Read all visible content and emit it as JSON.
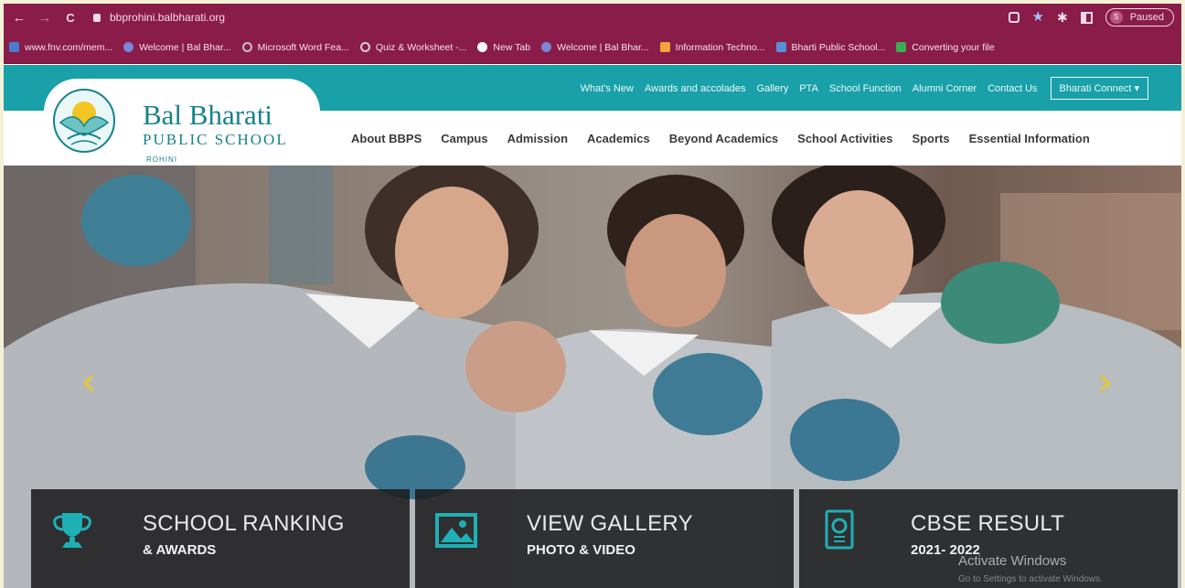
{
  "browser": {
    "url": "bbprohini.balbharati.org",
    "profile_status": "Paused",
    "profile_initial": "S",
    "nav": {
      "back": "←",
      "forward": "→",
      "reload": "C"
    }
  },
  "bookmarks": [
    {
      "label": "www.fnv.com/mem...",
      "color": "#4a7bd1"
    },
    {
      "label": "Welcome | Bal Bhar...",
      "color": "#7a86d6"
    },
    {
      "label": "Microsoft Word Fea...",
      "color": "#c9c0c4"
    },
    {
      "label": "Quiz & Worksheet -...",
      "color": "#d7cfd2"
    },
    {
      "label": "New Tab",
      "color": "#ffffff"
    },
    {
      "label": "Welcome | Bal Bhar...",
      "color": "#7a86d6"
    },
    {
      "label": "Information Techno...",
      "color": "#f2a33a"
    },
    {
      "label": "Bharti Public School...",
      "color": "#5a8fd8"
    },
    {
      "label": "Converting your file",
      "color": "#3faa52"
    }
  ],
  "site": {
    "top_links": [
      "What's New",
      "Awards and accolades",
      "Gallery",
      "PTA",
      "School Function",
      "Alumni Corner",
      "Contact Us"
    ],
    "connect_label": "Bharati Connect ▾",
    "logo": {
      "title": "Bal Bharati",
      "subtitle": "PUBLIC SCHOOL",
      "location": "ROHINI"
    },
    "main_nav": [
      "About BBPS",
      "Campus",
      "Admission",
      "Academics",
      "Beyond Academics",
      "School Activities",
      "Sports",
      "Essential Information"
    ],
    "colors": {
      "teal": "#19a0a8",
      "browser": "#8a1c4a",
      "arrow": "#e7c630",
      "card_bg": "#18181a"
    }
  },
  "hero": {
    "arrows": {
      "prev": "‹",
      "next": "›"
    },
    "cards": [
      {
        "title": "SCHOOL RANKING",
        "subtitle": "& AWARDS",
        "icon": "trophy-icon"
      },
      {
        "title": "VIEW GALLERY",
        "subtitle": "PHOTO & VIDEO",
        "icon": "image-icon"
      },
      {
        "title": "CBSE RESULT",
        "subtitle": "2021- 2022",
        "icon": "certificate-icon"
      }
    ]
  },
  "os_watermark": {
    "title": "Activate Windows",
    "subtitle": "Go to Settings to activate Windows."
  }
}
